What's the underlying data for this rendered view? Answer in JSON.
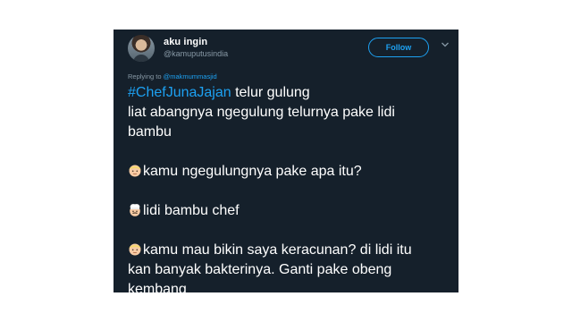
{
  "tweet": {
    "author_name": "aku ingin",
    "author_handle": "@kamuputusindia",
    "follow_label": "Follow",
    "reply_prefix": "Replying to ",
    "reply_mention": "@makmummasjid",
    "hashtag": "#ChefJunaJajan",
    "line1_rest": " telur gulung",
    "line2": "liat abangnya ngegulung telurnya pake lidi",
    "line3": "bambu",
    "q1": "kamu ngegulungnya pake apa itu?",
    "a1": "lidi bambu chef",
    "q2_line1": "kamu mau bikin saya keracunan? di lidi itu",
    "q2_line2": "kan banyak bakterinya. Ganti pake obeng",
    "q2_line3": "kembang"
  },
  "icons": {
    "questioner": "blond-person-emoji",
    "responder": "chef-emoji",
    "menu": "chevron-down-icon"
  },
  "colors": {
    "background": "#15202b",
    "accent": "#1da1f2",
    "text": "#ffffff",
    "secondary": "#8899a6"
  }
}
